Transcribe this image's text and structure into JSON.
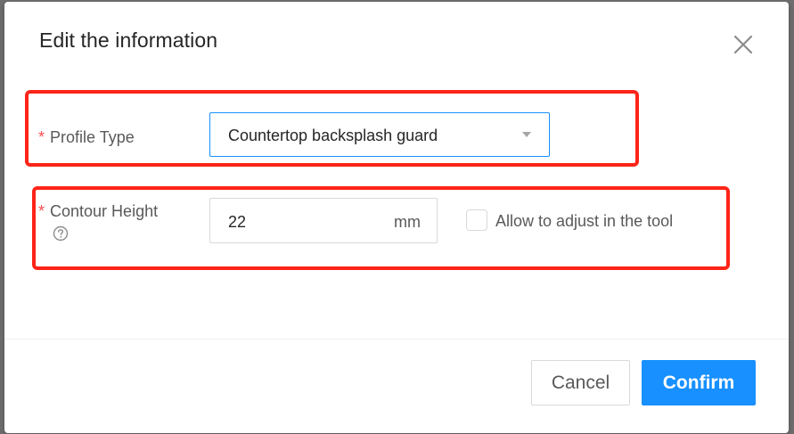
{
  "dialog": {
    "title": "Edit the information",
    "close_icon": "close-icon"
  },
  "fields": {
    "profile_type": {
      "required_mark": "*",
      "label": "Profile Type",
      "value": "Countertop backsplash guard",
      "arrow_icon": "caret-down-icon"
    },
    "contour_height": {
      "required_mark": "*",
      "label": "Contour Height",
      "help_icon": "question-circle-icon",
      "value": "22",
      "unit": "mm"
    },
    "adjust_checkbox": {
      "label": "Allow to adjust in the tool",
      "checked": false
    }
  },
  "footer": {
    "cancel_label": "Cancel",
    "confirm_label": "Confirm"
  },
  "colors": {
    "primary": "#1890ff",
    "highlight": "#ff2418",
    "required": "#ff4d4f"
  }
}
